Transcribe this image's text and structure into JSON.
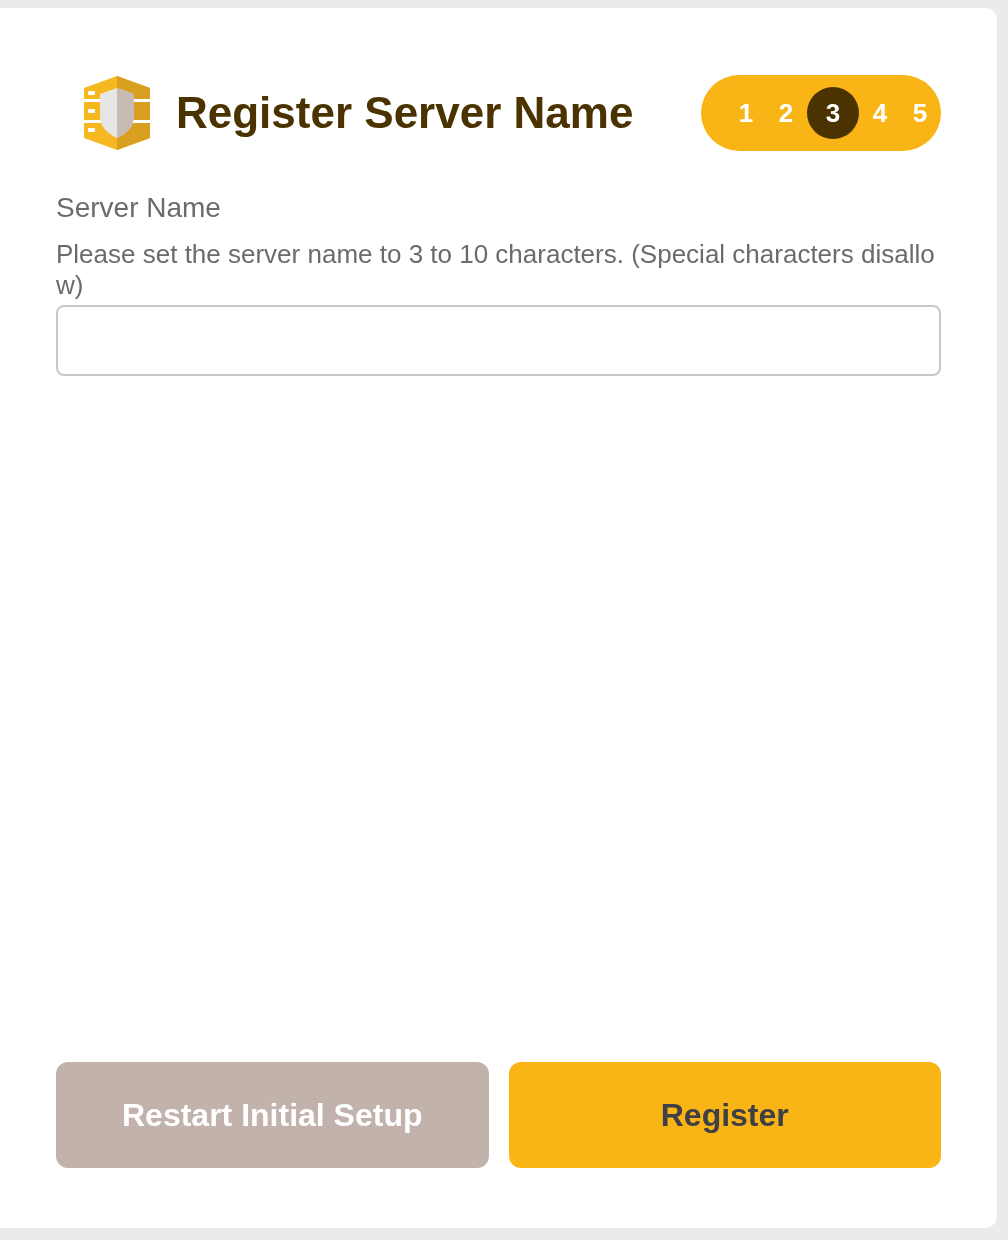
{
  "header": {
    "title": "Register Server Name",
    "steps": [
      {
        "label": "1",
        "selected": false
      },
      {
        "label": "2",
        "selected": false
      },
      {
        "label": "3",
        "selected": true
      },
      {
        "label": "4",
        "selected": false
      },
      {
        "label": "5",
        "selected": false
      }
    ]
  },
  "field": {
    "label": "Server Name",
    "hint": "Please set the server name to 3 to 10 characters. (Special characters disallow)"
  },
  "buttons": [
    {
      "label": "Restart Initial Setup",
      "kind": "secondary"
    },
    {
      "label": "Register",
      "kind": "primary"
    }
  ]
}
